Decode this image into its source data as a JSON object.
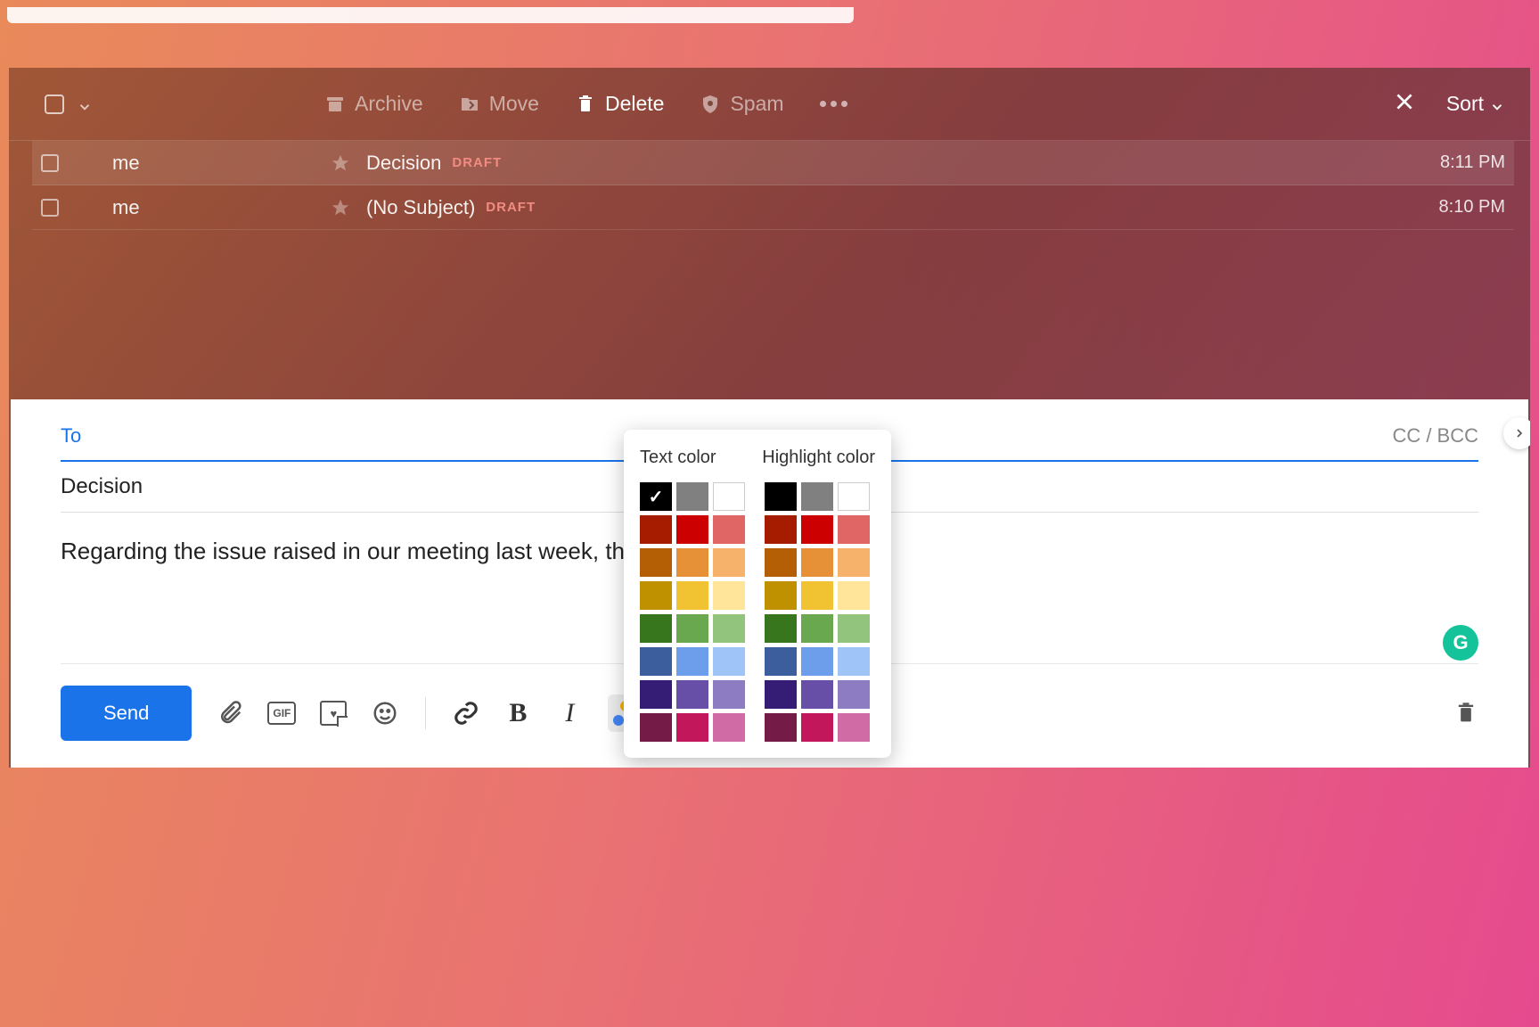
{
  "toolbar": {
    "archive": "Archive",
    "move": "Move",
    "delete": "Delete",
    "spam": "Spam",
    "sort": "Sort"
  },
  "messages": [
    {
      "sender": "me",
      "subject": "Decision",
      "badge": "DRAFT",
      "time": "8:11 PM",
      "selected": true
    },
    {
      "sender": "me",
      "subject": "(No Subject)",
      "badge": "DRAFT",
      "time": "8:10 PM",
      "selected": false
    }
  ],
  "compose": {
    "to_label": "To",
    "ccbcc": "CC / BCC",
    "subject": "Decision",
    "body": "Regarding the issue raised in our meeting last week, the",
    "send": "Send",
    "gif": "GIF"
  },
  "color_picker": {
    "text_label": "Text color",
    "highlight_label": "Highlight color",
    "selected_text_index": 0,
    "rows": [
      [
        "#000000",
        "#808080",
        "#ffffff"
      ],
      [
        "#a61c00",
        "#cc0000",
        "#e06666"
      ],
      [
        "#b45f06",
        "#e69138",
        "#f6b26b"
      ],
      [
        "#bf9000",
        "#f1c232",
        "#ffe599"
      ],
      [
        "#38761d",
        "#6aa84f",
        "#93c47d"
      ],
      [
        "#3d5e9c",
        "#6d9eeb",
        "#9fc5f8"
      ],
      [
        "#351c75",
        "#674ea7",
        "#8e7cc3"
      ],
      [
        "#741b47",
        "#c2185b",
        "#d16ba5"
      ]
    ]
  },
  "badges": {
    "grammarly": "G"
  }
}
